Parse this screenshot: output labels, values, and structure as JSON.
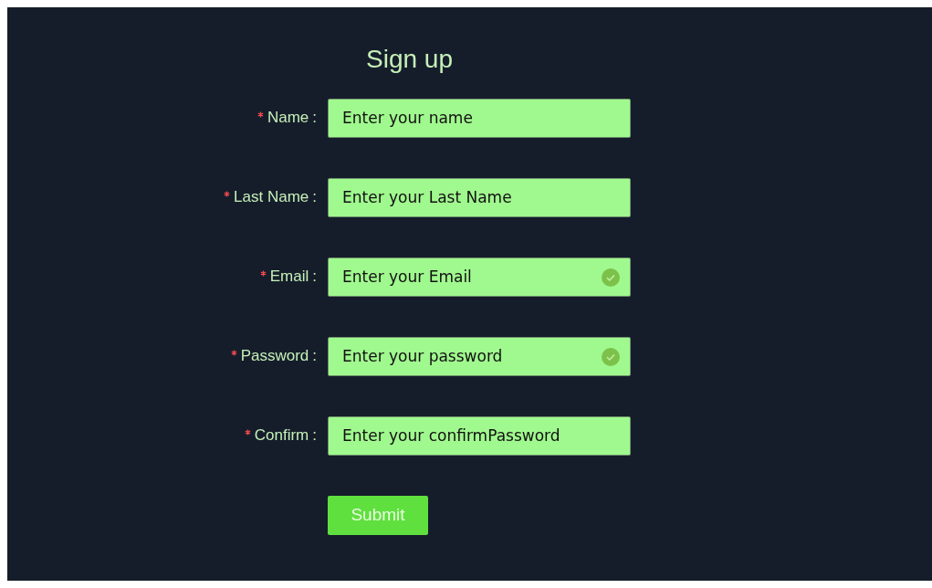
{
  "title": "Sign up",
  "fields": [
    {
      "label": "Name",
      "colon": ":",
      "required": true,
      "placeholder": "Enter your name",
      "valid": false
    },
    {
      "label": "Last Name",
      "colon": ":",
      "required": true,
      "placeholder": "Enter your Last Name",
      "valid": false
    },
    {
      "label": "Email",
      "colon": ":",
      "required": true,
      "placeholder": "Enter your Email",
      "valid": true
    },
    {
      "label": "Password",
      "colon": ":",
      "required": true,
      "placeholder": "Enter your password",
      "valid": true
    },
    {
      "label": "Confirm",
      "colon": ":",
      "required": true,
      "placeholder": "Enter your confirmPassword",
      "valid": false
    }
  ],
  "submit": "Submit"
}
